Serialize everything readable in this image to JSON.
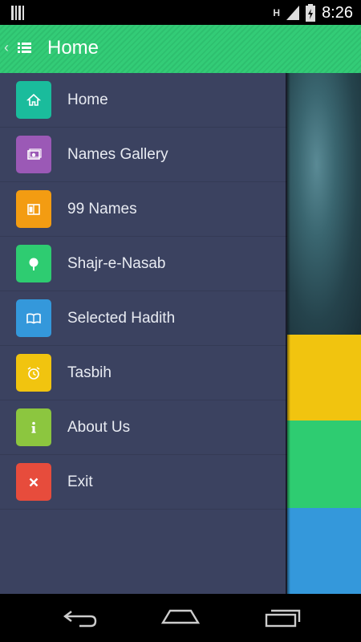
{
  "status_bar": {
    "network_type": "H",
    "time": "8:26"
  },
  "action_bar": {
    "title": "Home",
    "nav_icon": "list-icon"
  },
  "menu": {
    "items": [
      {
        "label": "Home",
        "icon": "home-icon",
        "color": "#1abc9c"
      },
      {
        "label": "Names Gallery",
        "icon": "gallery-icon",
        "color": "#9b59b6"
      },
      {
        "label": "99 Names",
        "icon": "book-icon",
        "color": "#f39c12"
      },
      {
        "label": "Shajr-e-Nasab",
        "icon": "tree-icon",
        "color": "#2ecc71"
      },
      {
        "label": "Selected Hadith",
        "icon": "open-book-icon",
        "color": "#3498db"
      },
      {
        "label": "Tasbih",
        "icon": "alarm-clock-icon",
        "color": "#f1c40f"
      },
      {
        "label": "About Us",
        "icon": "info-icon",
        "color": "#8cc63f"
      },
      {
        "label": "Exit",
        "icon": "close-icon",
        "color": "#e74c3c"
      }
    ]
  },
  "background_tiles": {
    "colors": [
      "#f1c40f",
      "#2ecc71",
      "#3498db"
    ]
  },
  "nav_bar": {
    "buttons": [
      "back-icon",
      "home-icon",
      "recents-icon"
    ]
  }
}
